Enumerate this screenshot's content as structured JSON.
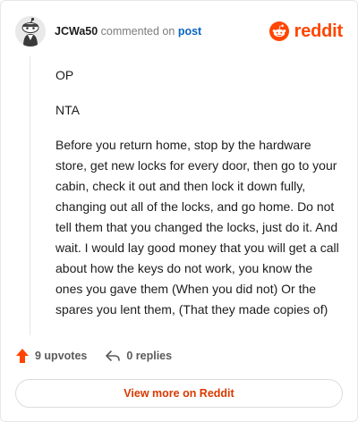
{
  "header": {
    "username": "JCWa50",
    "action_text": "commented on",
    "target_link": "post",
    "brand_name": "reddit",
    "brand_color": "#ff4500",
    "avatar_icon": "snoo-avatar-icon",
    "brand_icon": "reddit-logo-icon"
  },
  "comment": {
    "paragraphs": [
      "OP",
      "NTA",
      "Before you return home, stop by the hardware store, get new locks for every door, then go to your cabin, check it out and then lock it down fully, changing out all of the locks, and go home. Do not tell them that you changed the locks, just do it. And wait. I would lay good money that you will get a call about how the keys do not work, you know the ones you gave them (When you did not) Or the spares you lent them, (That they made copies of)"
    ]
  },
  "actions": {
    "upvotes_label": "9 upvotes",
    "replies_label": "0 replies",
    "upvote_icon": "upvote-arrow-icon",
    "reply_icon": "reply-arrow-icon"
  },
  "footer": {
    "view_more_label": "View more on Reddit",
    "accent_color": "#d93900"
  }
}
